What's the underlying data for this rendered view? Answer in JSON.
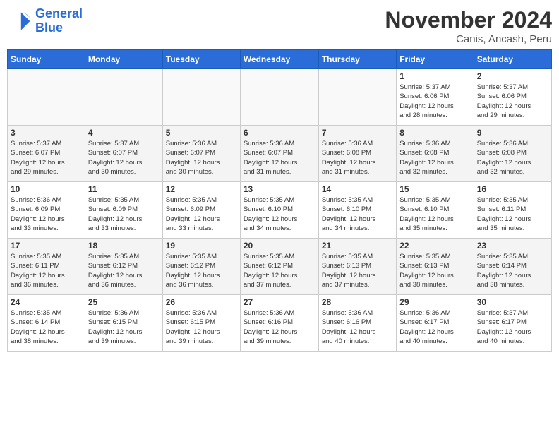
{
  "header": {
    "logo_line1": "General",
    "logo_line2": "Blue",
    "month_title": "November 2024",
    "location": "Canis, Ancash, Peru"
  },
  "weekdays": [
    "Sunday",
    "Monday",
    "Tuesday",
    "Wednesday",
    "Thursday",
    "Friday",
    "Saturday"
  ],
  "weeks": [
    [
      {
        "day": "",
        "info": ""
      },
      {
        "day": "",
        "info": ""
      },
      {
        "day": "",
        "info": ""
      },
      {
        "day": "",
        "info": ""
      },
      {
        "day": "",
        "info": ""
      },
      {
        "day": "1",
        "info": "Sunrise: 5:37 AM\nSunset: 6:06 PM\nDaylight: 12 hours\nand 28 minutes."
      },
      {
        "day": "2",
        "info": "Sunrise: 5:37 AM\nSunset: 6:06 PM\nDaylight: 12 hours\nand 29 minutes."
      }
    ],
    [
      {
        "day": "3",
        "info": "Sunrise: 5:37 AM\nSunset: 6:07 PM\nDaylight: 12 hours\nand 29 minutes."
      },
      {
        "day": "4",
        "info": "Sunrise: 5:37 AM\nSunset: 6:07 PM\nDaylight: 12 hours\nand 30 minutes."
      },
      {
        "day": "5",
        "info": "Sunrise: 5:36 AM\nSunset: 6:07 PM\nDaylight: 12 hours\nand 30 minutes."
      },
      {
        "day": "6",
        "info": "Sunrise: 5:36 AM\nSunset: 6:07 PM\nDaylight: 12 hours\nand 31 minutes."
      },
      {
        "day": "7",
        "info": "Sunrise: 5:36 AM\nSunset: 6:08 PM\nDaylight: 12 hours\nand 31 minutes."
      },
      {
        "day": "8",
        "info": "Sunrise: 5:36 AM\nSunset: 6:08 PM\nDaylight: 12 hours\nand 32 minutes."
      },
      {
        "day": "9",
        "info": "Sunrise: 5:36 AM\nSunset: 6:08 PM\nDaylight: 12 hours\nand 32 minutes."
      }
    ],
    [
      {
        "day": "10",
        "info": "Sunrise: 5:36 AM\nSunset: 6:09 PM\nDaylight: 12 hours\nand 33 minutes."
      },
      {
        "day": "11",
        "info": "Sunrise: 5:35 AM\nSunset: 6:09 PM\nDaylight: 12 hours\nand 33 minutes."
      },
      {
        "day": "12",
        "info": "Sunrise: 5:35 AM\nSunset: 6:09 PM\nDaylight: 12 hours\nand 33 minutes."
      },
      {
        "day": "13",
        "info": "Sunrise: 5:35 AM\nSunset: 6:10 PM\nDaylight: 12 hours\nand 34 minutes."
      },
      {
        "day": "14",
        "info": "Sunrise: 5:35 AM\nSunset: 6:10 PM\nDaylight: 12 hours\nand 34 minutes."
      },
      {
        "day": "15",
        "info": "Sunrise: 5:35 AM\nSunset: 6:10 PM\nDaylight: 12 hours\nand 35 minutes."
      },
      {
        "day": "16",
        "info": "Sunrise: 5:35 AM\nSunset: 6:11 PM\nDaylight: 12 hours\nand 35 minutes."
      }
    ],
    [
      {
        "day": "17",
        "info": "Sunrise: 5:35 AM\nSunset: 6:11 PM\nDaylight: 12 hours\nand 36 minutes."
      },
      {
        "day": "18",
        "info": "Sunrise: 5:35 AM\nSunset: 6:12 PM\nDaylight: 12 hours\nand 36 minutes."
      },
      {
        "day": "19",
        "info": "Sunrise: 5:35 AM\nSunset: 6:12 PM\nDaylight: 12 hours\nand 36 minutes."
      },
      {
        "day": "20",
        "info": "Sunrise: 5:35 AM\nSunset: 6:12 PM\nDaylight: 12 hours\nand 37 minutes."
      },
      {
        "day": "21",
        "info": "Sunrise: 5:35 AM\nSunset: 6:13 PM\nDaylight: 12 hours\nand 37 minutes."
      },
      {
        "day": "22",
        "info": "Sunrise: 5:35 AM\nSunset: 6:13 PM\nDaylight: 12 hours\nand 38 minutes."
      },
      {
        "day": "23",
        "info": "Sunrise: 5:35 AM\nSunset: 6:14 PM\nDaylight: 12 hours\nand 38 minutes."
      }
    ],
    [
      {
        "day": "24",
        "info": "Sunrise: 5:35 AM\nSunset: 6:14 PM\nDaylight: 12 hours\nand 38 minutes."
      },
      {
        "day": "25",
        "info": "Sunrise: 5:36 AM\nSunset: 6:15 PM\nDaylight: 12 hours\nand 39 minutes."
      },
      {
        "day": "26",
        "info": "Sunrise: 5:36 AM\nSunset: 6:15 PM\nDaylight: 12 hours\nand 39 minutes."
      },
      {
        "day": "27",
        "info": "Sunrise: 5:36 AM\nSunset: 6:16 PM\nDaylight: 12 hours\nand 39 minutes."
      },
      {
        "day": "28",
        "info": "Sunrise: 5:36 AM\nSunset: 6:16 PM\nDaylight: 12 hours\nand 40 minutes."
      },
      {
        "day": "29",
        "info": "Sunrise: 5:36 AM\nSunset: 6:17 PM\nDaylight: 12 hours\nand 40 minutes."
      },
      {
        "day": "30",
        "info": "Sunrise: 5:37 AM\nSunset: 6:17 PM\nDaylight: 12 hours\nand 40 minutes."
      }
    ]
  ]
}
